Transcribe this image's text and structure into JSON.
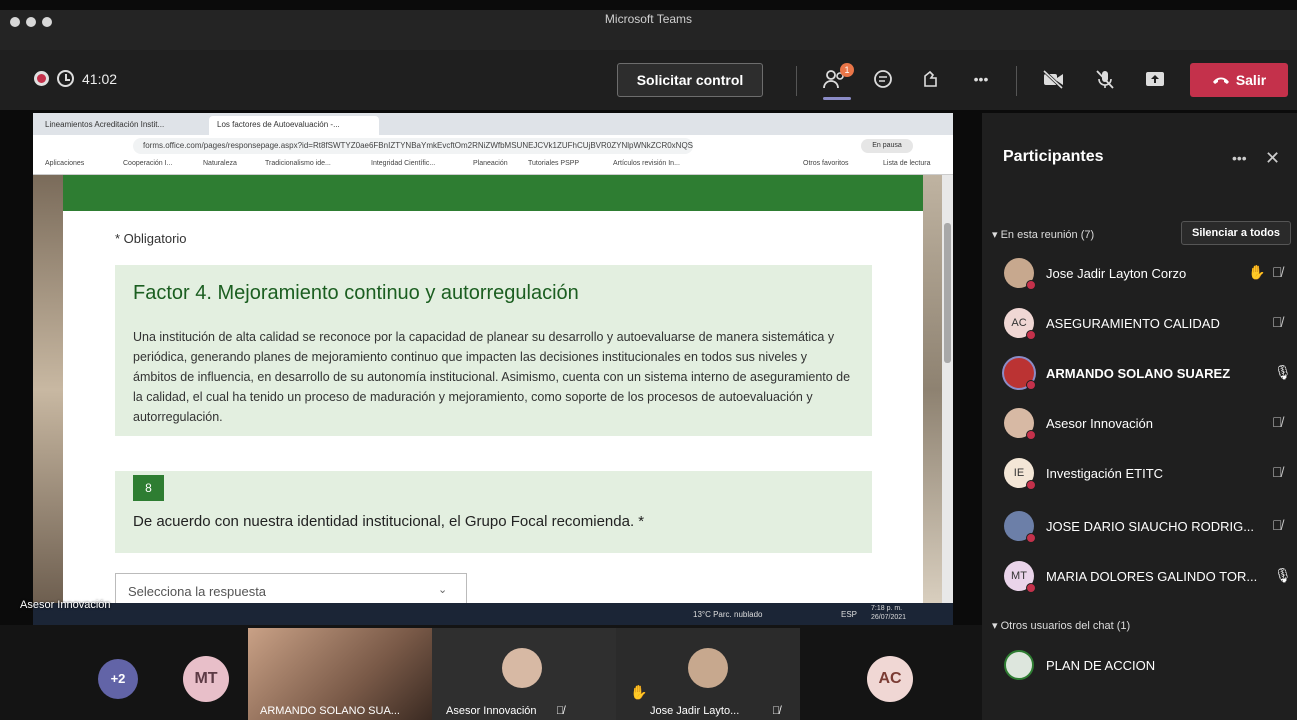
{
  "window": {
    "title": "Microsoft Teams"
  },
  "toolbar": {
    "timer": "41:02",
    "request_control_label": "Solicitar control",
    "participants_badge": "1",
    "leave_label": "Salir",
    "more_label": "•••"
  },
  "browser": {
    "tabs": [
      "Lineamientos Acreditación Instit...",
      "Los factores de Autoevaluación -..."
    ],
    "url": "forms.office.com/pages/responsepage.aspx?id=Rt8fSWTYZ0ae6FBnIZTYNBaYmkEvcftOm2RNiZWfbMSUNEJCVk1ZUFhCUjBVR0ZYNlpWNkZCR0xNQS4u",
    "paused_label": "En pausa",
    "bookmarks": [
      "Aplicaciones",
      "Cooperación I...",
      "Naturaleza",
      "Tradicionalismo ide...",
      "Integridad Científic...",
      "Planeación",
      "Tutoriales PSPP",
      "Artículos revisión In...",
      "Otros favoritos",
      "Lista de lectura"
    ]
  },
  "form": {
    "required_note": "* Obligatorio",
    "section_title": "Factor 4. Mejoramiento continuo y autorregulación",
    "section_desc": "Una institución de alta calidad se reconoce por la capacidad de planear su desarrollo y autoevaluarse de manera sistemática y periódica, generando planes de mejoramiento continuo que impacten las decisiones institucionales en todos sus niveles y ámbitos de influencia, en desarrollo de su autonomía institucional. Asimismo, cuenta con un sistema interno de aseguramiento de la calidad, el cual ha tenido un proceso de maduración y mejoramiento, como soporte de los procesos de autoevaluación y autorregulación.",
    "question_number": "8",
    "question_text": "De acuerdo con nuestra identidad institucional, el Grupo Focal recomienda. *",
    "select_placeholder": "Selecciona la respuesta"
  },
  "os_taskbar": {
    "weather": "13°C Parc. nublado",
    "lang": "ESP",
    "time": "7:18 p. m.",
    "date": "26/07/2021"
  },
  "share_presenter": "Asesor Innovación",
  "panel": {
    "title": "Participantes",
    "in_meeting_label": "En esta reunión (7)",
    "mute_all_label": "Silenciar a todos",
    "participants": [
      {
        "name": "Jose Jadir Layton Corzo",
        "initials": "",
        "hand": true,
        "mic": "muted"
      },
      {
        "name": "ASEGURAMIENTO CALIDAD",
        "initials": "AC",
        "mic": "muted"
      },
      {
        "name": "ARMANDO SOLANO SUAREZ",
        "initials": "",
        "mic": "on",
        "speaking": true
      },
      {
        "name": "Asesor Innovación",
        "initials": "",
        "mic": "muted"
      },
      {
        "name": "Investigación ETITC",
        "initials": "IE",
        "mic": "muted"
      },
      {
        "name": "JOSE DARIO SIAUCHO RODRIG...",
        "initials": "",
        "mic": "muted"
      },
      {
        "name": "MARIA DOLORES GALINDO TOR...",
        "initials": "MT",
        "mic": "on"
      }
    ],
    "other_chat_label": "Otros usuarios del chat (1)",
    "other_users": [
      {
        "name": "PLAN DE ACCION"
      }
    ]
  },
  "video_strip": {
    "overflow": "+2",
    "tiles": [
      {
        "initials": "MT"
      },
      {
        "name": "ARMANDO SOLANO SUA..."
      },
      {
        "name": "Asesor Innovación"
      },
      {
        "name": "Jose Jadir Layto..."
      },
      {
        "initials": "AC"
      }
    ]
  },
  "colors": {
    "accent": "#8b8cc7",
    "leave": "#c4314b",
    "forms_green": "#2e7d32",
    "badge": "#e97548"
  }
}
